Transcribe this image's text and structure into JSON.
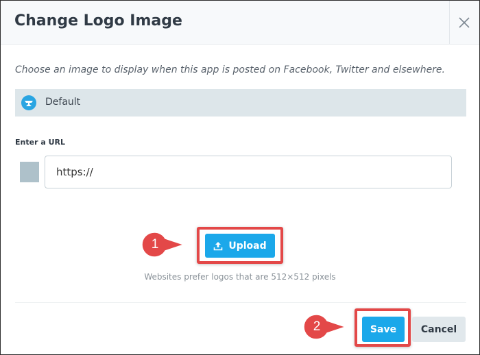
{
  "dialog": {
    "title": "Change Logo Image",
    "description": "Choose an image to display when this app is posted on Facebook, Twitter and elsewhere.",
    "close_icon": "close-icon"
  },
  "logo_option": {
    "label": "Default",
    "icon": "anvil-logo-icon",
    "icon_color": "#2aa5e2"
  },
  "url": {
    "label": "Enter a URL",
    "value": "https://"
  },
  "upload": {
    "label": "Upload",
    "icon": "upload-icon",
    "hint": "Websites prefer logos that are 512×512 pixels"
  },
  "footer": {
    "save_label": "Save",
    "cancel_label": "Cancel"
  },
  "annotations": [
    {
      "number": "1",
      "target": "upload-button"
    },
    {
      "number": "2",
      "target": "save-button"
    }
  ],
  "colors": {
    "primary": "#1ba8ea",
    "highlight": "#e34848"
  }
}
